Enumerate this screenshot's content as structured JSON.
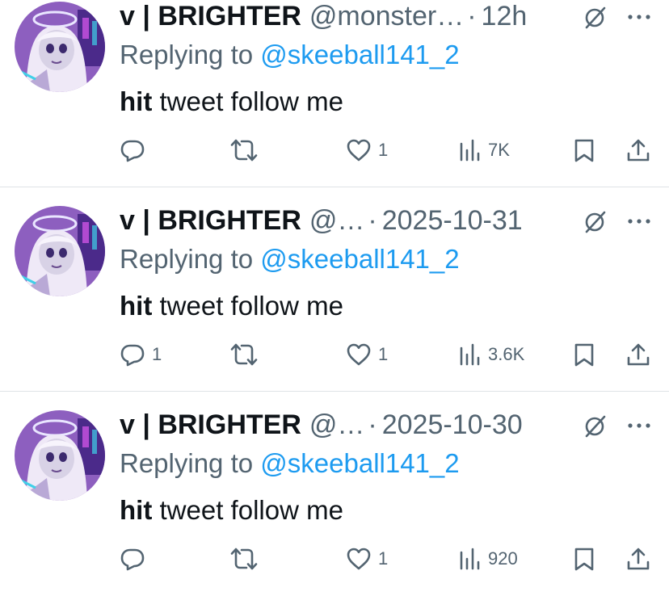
{
  "colors": {
    "text_primary": "#0f1419",
    "text_secondary": "#536471",
    "mention_blue": "#1d9bf0",
    "divider": "#dfe3e6",
    "avatar_purple": "#8d5fbf"
  },
  "icons": {
    "reply": "reply-icon",
    "retweet": "retweet-icon",
    "like": "heart-icon",
    "views": "views-icon",
    "bookmark": "bookmark-icon",
    "share": "share-icon",
    "grok": "grok-icon",
    "more": "more-icon"
  },
  "tweets": [
    {
      "name": "v | BRIGHTER",
      "handle": "@monster…",
      "dot": "·",
      "time": "12h",
      "reply_prefix": "Replying to",
      "mention": "@skeeball141_2",
      "text_bold": "hit",
      "text_rest": "tweet follow me",
      "replies": "",
      "retweets": "",
      "likes": "1",
      "views": "7K"
    },
    {
      "name": "v | BRIGHTER",
      "handle": "@…",
      "dot": "·",
      "time": "2025-10-31",
      "reply_prefix": "Replying to",
      "mention": "@skeeball141_2",
      "text_bold": "hit",
      "text_rest": "tweet follow me",
      "replies": "1",
      "retweets": "",
      "likes": "1",
      "views": "3.6K"
    },
    {
      "name": "v | BRIGHTER",
      "handle": "@…",
      "dot": "·",
      "time": "2025-10-30",
      "reply_prefix": "Replying to",
      "mention": "@skeeball141_2",
      "text_bold": "hit",
      "text_rest": "tweet follow me",
      "replies": "",
      "retweets": "",
      "likes": "1",
      "views": "920"
    }
  ]
}
